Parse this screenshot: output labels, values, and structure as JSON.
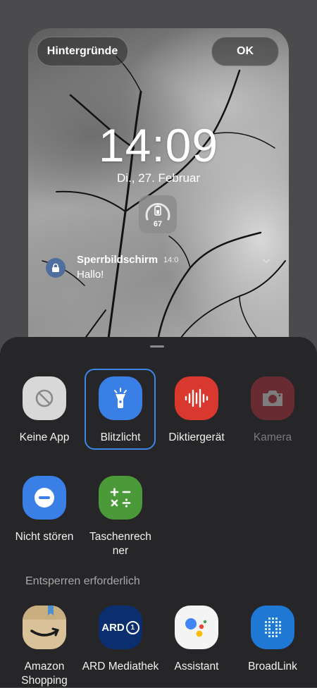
{
  "header": {
    "wallpapers_label": "Hintergründe",
    "ok_label": "OK"
  },
  "lockscreen": {
    "time": "14:09",
    "date": "Di., 27. Februar",
    "battery_percent": "67",
    "notification": {
      "app": "Sperrbildschirm",
      "time": "14:0",
      "text": "Hallo!"
    }
  },
  "sheet": {
    "selected_app": "Blitzlicht",
    "apps_row1": [
      {
        "label": "Keine App",
        "icon": "block-icon"
      },
      {
        "label": "Blitzlicht",
        "icon": "flashlight-icon",
        "accent": "#3a7fe6"
      },
      {
        "label": "Diktiergerät",
        "icon": "voice-recorder-icon",
        "accent": "#d8382e"
      },
      {
        "label": "Kamera",
        "icon": "camera-icon",
        "accent": "#b8323c"
      }
    ],
    "apps_row2": [
      {
        "label": "Nicht stören",
        "icon": "do-not-disturb-icon",
        "accent": "#3a7fe6"
      },
      {
        "label": "Taschenrechner",
        "icon": "calculator-icon",
        "accent": "#4a9a3a"
      }
    ],
    "unlock_required_label": "Entsperren erforderlich",
    "apps_row3": [
      {
        "label": "Amazon Shopping",
        "icon": "amazon-icon"
      },
      {
        "label": "ARD Mediathek",
        "icon": "ard-icon",
        "icon_text": "ARD"
      },
      {
        "label": "Assistant",
        "icon": "assistant-icon"
      },
      {
        "label": "BroadLink",
        "icon": "broadlink-icon"
      }
    ]
  }
}
